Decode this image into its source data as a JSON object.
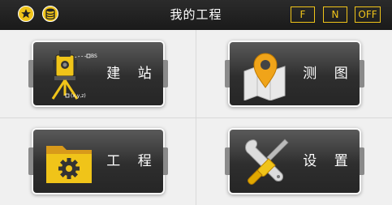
{
  "header": {
    "title": "我的工程",
    "buttons": {
      "f": "F",
      "n": "N",
      "off": "OFF"
    },
    "icons": [
      "star-icon",
      "database-icon"
    ]
  },
  "tiles": {
    "station": {
      "label": "建 站",
      "icon": "total-station-icon",
      "annotation_bs": "BS",
      "annotation_xyz": "(x,y,z)"
    },
    "survey": {
      "label": "测 图",
      "icon": "map-pin-icon"
    },
    "project": {
      "label": "工 程",
      "icon": "folder-gear-icon"
    },
    "settings": {
      "label": "设 置",
      "icon": "wrench-screwdriver-icon"
    }
  },
  "colors": {
    "accent": "#f0c419",
    "tile_dark": "#2e2e2e",
    "header_bg": "#222222"
  }
}
